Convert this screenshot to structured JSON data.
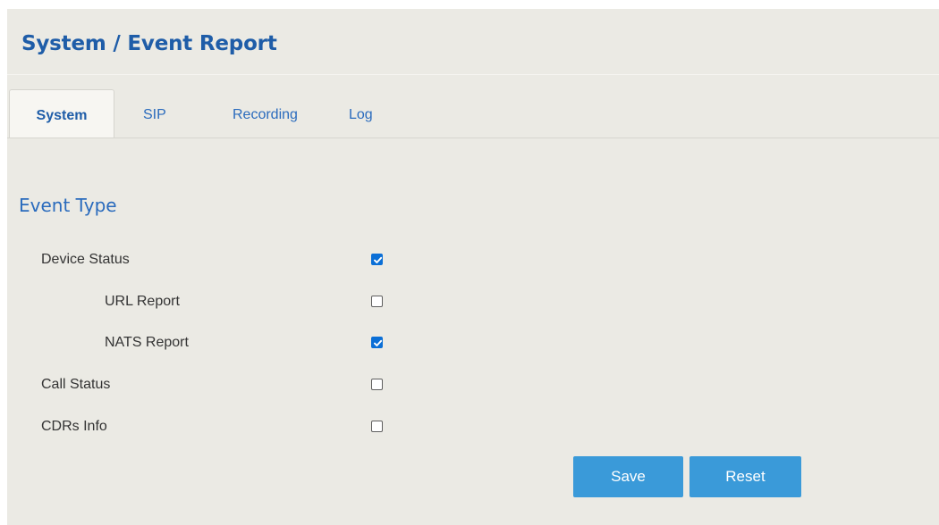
{
  "page": {
    "title": "System / Event Report"
  },
  "tabs": [
    {
      "label": "System",
      "active": true
    },
    {
      "label": "SIP",
      "active": false
    },
    {
      "label": "Recording",
      "active": false
    },
    {
      "label": "Log",
      "active": false
    }
  ],
  "event_type": {
    "heading": "Event Type",
    "rows": [
      {
        "label": "Device Status",
        "checked": true
      },
      {
        "label": "URL Report",
        "checked": false
      },
      {
        "label": "NATS Report",
        "checked": true
      },
      {
        "label": "Call Status",
        "checked": false
      },
      {
        "label": "CDRs Info",
        "checked": false
      }
    ]
  },
  "actions": {
    "save_label": "Save",
    "reset_label": "Reset"
  },
  "colors": {
    "panel_background": "#ebeae4",
    "title_blue": "#1f5da8",
    "link_blue": "#2a6bbd",
    "checkbox_checked": "#0b6fd6",
    "button_blue": "#3a9ad9"
  }
}
